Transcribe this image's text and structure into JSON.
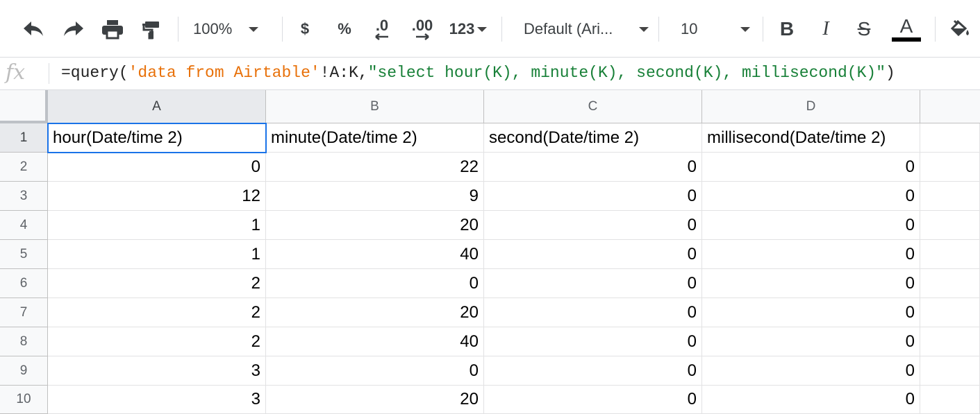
{
  "toolbar": {
    "zoom": "100%",
    "currency": "$",
    "percent": "%",
    "decrease_decimal": ".0",
    "increase_decimal": ".00",
    "more_formats": "123",
    "font_name": "Default (Ari...",
    "font_size": "10",
    "bold": "B",
    "italic": "I",
    "strikethrough": "S",
    "text_color_letter": "A",
    "text_color": "#000000"
  },
  "formula_bar": {
    "fx": "fx",
    "part1": "=query(",
    "part2": "'data from Airtable'",
    "part3": "!A:K,",
    "part4": "\"select hour(K), minute(K), second(K), millisecond(K)\"",
    "part5": ")"
  },
  "grid": {
    "columns": [
      "A",
      "B",
      "C",
      "D"
    ],
    "rows": [
      {
        "n": "1",
        "cells": [
          "hour(Date/time 2)",
          "minute(Date/time 2)",
          "second(Date/time 2)",
          "millisecond(Date/time 2)"
        ]
      },
      {
        "n": "2",
        "cells": [
          "0",
          "22",
          "0",
          "0"
        ]
      },
      {
        "n": "3",
        "cells": [
          "12",
          "9",
          "0",
          "0"
        ]
      },
      {
        "n": "4",
        "cells": [
          "1",
          "20",
          "0",
          "0"
        ]
      },
      {
        "n": "5",
        "cells": [
          "1",
          "40",
          "0",
          "0"
        ]
      },
      {
        "n": "6",
        "cells": [
          "2",
          "0",
          "0",
          "0"
        ]
      },
      {
        "n": "7",
        "cells": [
          "2",
          "20",
          "0",
          "0"
        ]
      },
      {
        "n": "8",
        "cells": [
          "2",
          "40",
          "0",
          "0"
        ]
      },
      {
        "n": "9",
        "cells": [
          "3",
          "0",
          "0",
          "0"
        ]
      },
      {
        "n": "10",
        "cells": [
          "3",
          "20",
          "0",
          "0"
        ]
      }
    ],
    "selected_cell": "A1"
  },
  "colors": {
    "selection": "#1a73e8",
    "formula_string": "#e8710a",
    "formula_query": "#188038"
  }
}
